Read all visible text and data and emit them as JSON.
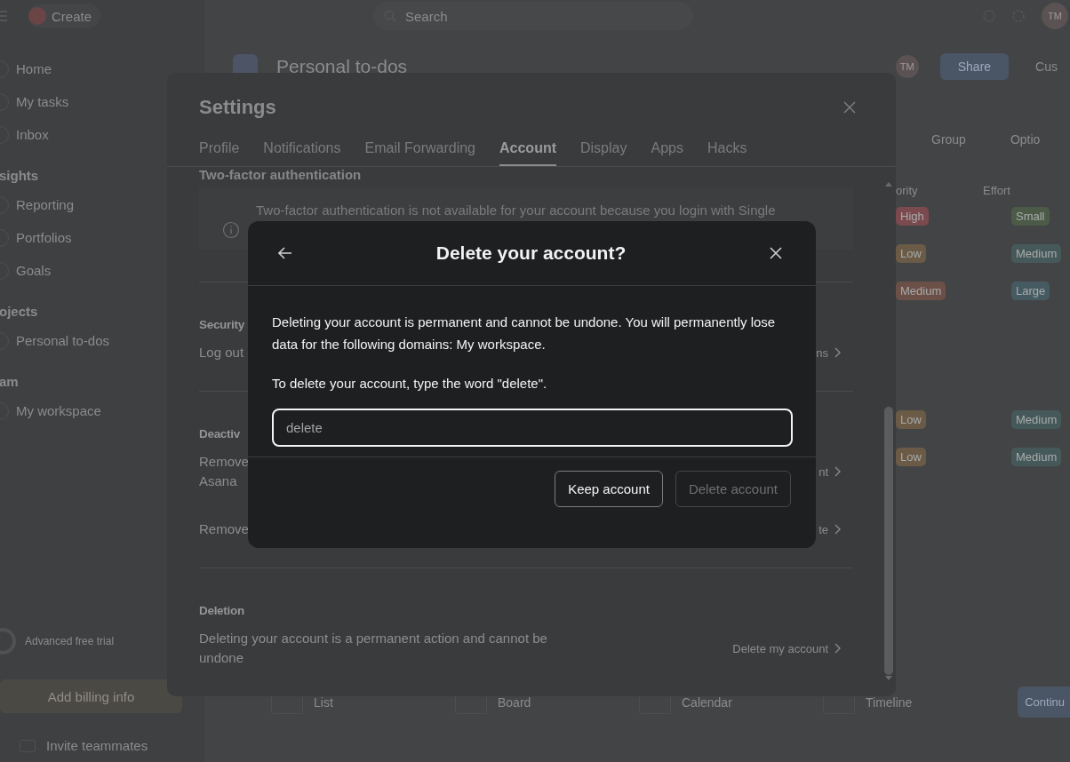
{
  "topbar": {
    "create_label": "Create",
    "search_placeholder": "Search",
    "avatar": "TM"
  },
  "sidebar": {
    "items": [
      {
        "label": "Home",
        "kind": "item"
      },
      {
        "label": "My tasks",
        "kind": "item"
      },
      {
        "label": "Inbox",
        "kind": "item"
      },
      {
        "label": "sights",
        "kind": "header"
      },
      {
        "label": "Reporting",
        "kind": "item"
      },
      {
        "label": "Portfolios",
        "kind": "item"
      },
      {
        "label": "Goals",
        "kind": "item"
      },
      {
        "label": "ojects",
        "kind": "header"
      },
      {
        "label": "Personal to-dos",
        "kind": "item"
      },
      {
        "label": "am",
        "kind": "header"
      },
      {
        "label": "My workspace",
        "kind": "item"
      }
    ],
    "trial": "Advanced free trial",
    "billing_button": "Add billing info",
    "invite": "Invite teammates"
  },
  "project": {
    "title": "Personal to-dos",
    "avatar": "TM",
    "share": "Share",
    "customize": "Cus",
    "toolbar": [
      "Group",
      "Optio"
    ],
    "columns": [
      "ority",
      "Effort"
    ],
    "groups": [
      {
        "rows": [
          {
            "priority": {
              "label": "High",
              "color": "#7a4a4e"
            },
            "effort": {
              "label": "Small",
              "color": "#4c5b48"
            }
          },
          {
            "priority": {
              "label": "Low",
              "color": "#6a5a46"
            },
            "effort": {
              "label": "Medium",
              "color": "#46595a"
            }
          },
          {
            "priority": {
              "label": "Medium",
              "color": "#6b5048"
            },
            "effort": {
              "label": "Large",
              "color": "#465a62"
            }
          }
        ]
      },
      {
        "rows": [
          {
            "priority": {
              "label": "Low",
              "color": "#6a5a46"
            },
            "effort": {
              "label": "Medium",
              "color": "#46595a"
            }
          },
          {
            "priority": {
              "label": "Low",
              "color": "#6a5a46"
            },
            "effort": {
              "label": "Medium",
              "color": "#46595a"
            }
          }
        ]
      }
    ],
    "views": [
      "List",
      "Board",
      "Calendar",
      "Timeline"
    ],
    "continue": "Continu"
  },
  "settings": {
    "title": "Settings",
    "tabs": [
      {
        "label": "Profile",
        "selected": false
      },
      {
        "label": "Notifications",
        "selected": false
      },
      {
        "label": "Email Forwarding",
        "selected": false
      },
      {
        "label": "Account",
        "selected": true
      },
      {
        "label": "Display",
        "selected": false
      },
      {
        "label": "Apps",
        "selected": false
      },
      {
        "label": "Hacks",
        "selected": false
      }
    ],
    "two_factor": {
      "title": "Two-factor authentication",
      "notice": "Two-factor authentication is not available for your account because you login with Single"
    },
    "sections": [
      {
        "title": "Security",
        "rows": [
          {
            "text": "Log out",
            "action": "ns"
          }
        ]
      },
      {
        "title": "Deactiv",
        "rows": [
          {
            "lines": [
              "Remove",
              "Asana"
            ],
            "action": "nt"
          },
          {
            "text": "Remove",
            "action": "te"
          }
        ]
      },
      {
        "title": "Deletion",
        "rows": [
          {
            "text": "Deleting your account is a permanent action and cannot be undone",
            "action": "Delete my account"
          }
        ]
      }
    ]
  },
  "delete_dialog": {
    "title": "Delete your account?",
    "message": "Deleting your account is permanent and cannot be undone. You will permanently lose data for the following domains: My workspace.",
    "instruction": "To delete your account, type the word \"delete\".",
    "input": {
      "placeholder": "delete"
    },
    "buttons": [
      {
        "label": "Keep account",
        "disabled": false
      },
      {
        "label": "Delete account",
        "disabled": true
      }
    ]
  }
}
